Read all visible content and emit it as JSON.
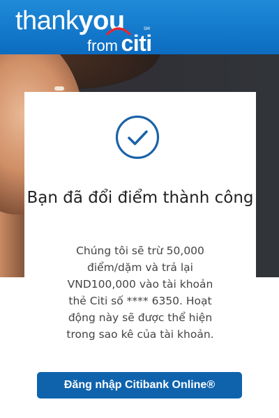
{
  "brand": {
    "logo_line1_a": "thank",
    "logo_line1_b": "you",
    "logo_line2_from": "from",
    "logo_line2_citi": "citi",
    "logo_sm": "SM"
  },
  "card": {
    "title": "Bạn đã đổi điểm thành công",
    "description": "Chúng tôi sẽ trừ 50,000 điểm/dặm và trả lại VND100,000 vào tài khoản thẻ Citi số **** 6350. Hoạt động này sẽ được thể hiện trong sao kê của tài khoản.",
    "button_label": "Đăng nhập Citibank Online®"
  },
  "icons": {
    "success": "check-circle-icon"
  },
  "colors": {
    "header_blue": "#1479cc",
    "check_blue": "#1a63a8",
    "button_blue": "#0f63ad"
  }
}
